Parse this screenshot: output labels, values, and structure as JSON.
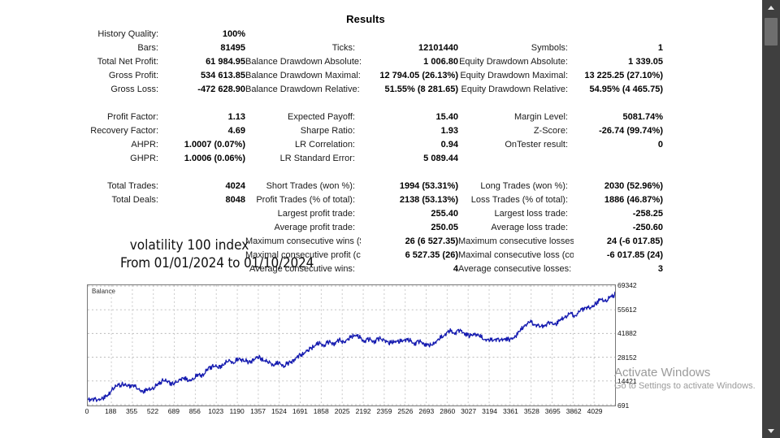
{
  "window": {
    "title": "Results"
  },
  "stats": {
    "groups": [
      {
        "name": "summary",
        "rows": [
          [
            {
              "label": "History Quality:",
              "value": "100%"
            },
            {
              "label": "",
              "value": ""
            },
            {
              "label": "",
              "value": ""
            }
          ],
          [
            {
              "label": "Bars:",
              "value": "81495"
            },
            {
              "label": "Ticks:",
              "value": "12101440"
            },
            {
              "label": "Symbols:",
              "value": "1"
            }
          ],
          [
            {
              "label": "Total Net Profit:",
              "value": "61 984.95"
            },
            {
              "label": "Balance Drawdown Absolute:",
              "value": "1 006.80"
            },
            {
              "label": "Equity Drawdown Absolute:",
              "value": "1 339.05"
            }
          ],
          [
            {
              "label": "Gross Profit:",
              "value": "534 613.85"
            },
            {
              "label": "Balance Drawdown Maximal:",
              "value": "12 794.05 (26.13%)"
            },
            {
              "label": "Equity Drawdown Maximal:",
              "value": "13 225.25 (27.10%)"
            }
          ],
          [
            {
              "label": "Gross Loss:",
              "value": "-472 628.90"
            },
            {
              "label": "Balance Drawdown Relative:",
              "value": "51.55% (8 281.65)"
            },
            {
              "label": "Equity Drawdown Relative:",
              "value": "54.95% (4 465.75)"
            }
          ]
        ]
      },
      {
        "name": "ratios",
        "rows": [
          [
            {
              "label": "Profit Factor:",
              "value": "1.13"
            },
            {
              "label": "Expected Payoff:",
              "value": "15.40"
            },
            {
              "label": "Margin Level:",
              "value": "5081.74%"
            }
          ],
          [
            {
              "label": "Recovery Factor:",
              "value": "4.69"
            },
            {
              "label": "Sharpe Ratio:",
              "value": "1.93"
            },
            {
              "label": "Z-Score:",
              "value": "-26.74 (99.74%)"
            }
          ],
          [
            {
              "label": "AHPR:",
              "value": "1.0007 (0.07%)"
            },
            {
              "label": "LR Correlation:",
              "value": "0.94"
            },
            {
              "label": "OnTester result:",
              "value": "0"
            }
          ],
          [
            {
              "label": "GHPR:",
              "value": "1.0006 (0.06%)"
            },
            {
              "label": "LR Standard Error:",
              "value": "5 089.44"
            },
            {
              "label": "",
              "value": ""
            }
          ]
        ]
      },
      {
        "name": "trades",
        "rows": [
          [
            {
              "label": "Total Trades:",
              "value": "4024"
            },
            {
              "label": "Short Trades (won %):",
              "value": "1994 (53.31%)"
            },
            {
              "label": "Long Trades (won %):",
              "value": "2030 (52.96%)"
            }
          ],
          [
            {
              "label": "Total Deals:",
              "value": "8048"
            },
            {
              "label": "Profit Trades (% of total):",
              "value": "2138 (53.13%)"
            },
            {
              "label": "Loss Trades (% of total):",
              "value": "1886 (46.87%)"
            }
          ],
          [
            {
              "label": "",
              "value": ""
            },
            {
              "label": "Largest profit trade:",
              "value": "255.40"
            },
            {
              "label": "Largest loss trade:",
              "value": "-258.25"
            }
          ],
          [
            {
              "label": "",
              "value": ""
            },
            {
              "label": "Average profit trade:",
              "value": "250.05"
            },
            {
              "label": "Average loss trade:",
              "value": "-250.60"
            }
          ],
          [
            {
              "label": "",
              "value": ""
            },
            {
              "label": "Maximum consecutive wins ($):",
              "value": "26 (6 527.35)"
            },
            {
              "label": "Maximum consecutive losses ($):",
              "value": "24 (-6 017.85)"
            }
          ],
          [
            {
              "label": "",
              "value": ""
            },
            {
              "label": "Maximal consecutive profit (count):",
              "value": "6 527.35 (26)"
            },
            {
              "label": "Maximal consecutive loss (count):",
              "value": "-6 017.85 (24)"
            }
          ],
          [
            {
              "label": "",
              "value": ""
            },
            {
              "label": "Average consecutive wins:",
              "value": "4"
            },
            {
              "label": "Average consecutive losses:",
              "value": "3"
            }
          ]
        ]
      }
    ]
  },
  "caption": {
    "line1": "volatility 100 index",
    "line2": "From 01/01/2024 to 01/10/2024"
  },
  "watermark": {
    "line1": "Activate Windows",
    "line2": "Go to Settings to activate Windows."
  },
  "chart_data": {
    "type": "line",
    "title": "",
    "legend": "Balance",
    "legend_position": "top-left",
    "xlabel": "",
    "ylabel": "",
    "grid": true,
    "line_color": "#161cb0",
    "xlim": [
      0,
      4196
    ],
    "ylim": [
      691,
      69342
    ],
    "ytick_labels": [
      "69342",
      "55612",
      "41882",
      "28152",
      "14421",
      "691"
    ],
    "yticks": [
      69342,
      55612,
      41882,
      28152,
      14421,
      691
    ],
    "xtick_labels": [
      "0",
      "188",
      "355",
      "522",
      "689",
      "856",
      "1023",
      "1190",
      "1357",
      "1524",
      "1691",
      "1858",
      "2025",
      "2192",
      "2359",
      "2526",
      "2693",
      "2860",
      "3027",
      "3194",
      "3361",
      "3528",
      "3695",
      "3862",
      "4029"
    ],
    "xticks": [
      0,
      188,
      355,
      522,
      689,
      856,
      1023,
      1190,
      1357,
      1524,
      1691,
      1858,
      2025,
      2192,
      2359,
      2526,
      2693,
      2860,
      3027,
      3194,
      3361,
      3528,
      3695,
      3862,
      4029
    ],
    "series": [
      {
        "name": "Balance",
        "x": [
          0,
          40,
          80,
          120,
          160,
          200,
          240,
          280,
          320,
          360,
          400,
          440,
          480,
          520,
          560,
          600,
          640,
          680,
          720,
          760,
          800,
          840,
          880,
          920,
          960,
          1000,
          1040,
          1080,
          1120,
          1160,
          1200,
          1240,
          1280,
          1320,
          1360,
          1400,
          1440,
          1480,
          1520,
          1560,
          1600,
          1640,
          1680,
          1720,
          1760,
          1800,
          1840,
          1880,
          1920,
          1960,
          2000,
          2040,
          2080,
          2120,
          2160,
          2200,
          2240,
          2280,
          2320,
          2360,
          2400,
          2440,
          2480,
          2520,
          2560,
          2600,
          2640,
          2680,
          2720,
          2760,
          2800,
          2840,
          2880,
          2920,
          2960,
          3000,
          3040,
          3080,
          3120,
          3160,
          3200,
          3240,
          3280,
          3320,
          3360,
          3400,
          3440,
          3480,
          3520,
          3560,
          3600,
          3640,
          3680,
          3720,
          3760,
          3800,
          3840,
          3880,
          3920,
          3960,
          4000,
          4040,
          4080,
          4120,
          4160,
          4196
        ],
        "y": [
          3500,
          4100,
          3200,
          4600,
          5600,
          10200,
          11700,
          12600,
          11200,
          12300,
          9600,
          8300,
          9200,
          10300,
          12400,
          15100,
          13600,
          12700,
          14200,
          16600,
          14200,
          16000,
          17900,
          18000,
          21600,
          23300,
          22300,
          24100,
          26200,
          25300,
          27000,
          26800,
          24900,
          27000,
          28400,
          26600,
          25200,
          23900,
          24800,
          23300,
          24700,
          26700,
          28900,
          30700,
          32400,
          34700,
          36200,
          35300,
          37000,
          36100,
          38200,
          36900,
          38900,
          41200,
          39700,
          37800,
          38500,
          37300,
          39000,
          38200,
          36100,
          37600,
          36900,
          38800,
          37800,
          36200,
          37400,
          36000,
          34800,
          36700,
          38800,
          41500,
          43300,
          42300,
          43800,
          42100,
          40600,
          41900,
          40200,
          38700,
          37700,
          38900,
          37900,
          39200,
          38300,
          40100,
          43300,
          46800,
          48500,
          47200,
          45800,
          46900,
          48200,
          47100,
          49400,
          51600,
          53300,
          52200,
          54900,
          57200,
          56400,
          58900,
          61400,
          60700,
          62800,
          64600,
          63800,
          66100
        ]
      }
    ]
  },
  "scrollbar": {
    "up_arrow": "scroll-up-arrow",
    "down_arrow": "scroll-down-arrow"
  }
}
